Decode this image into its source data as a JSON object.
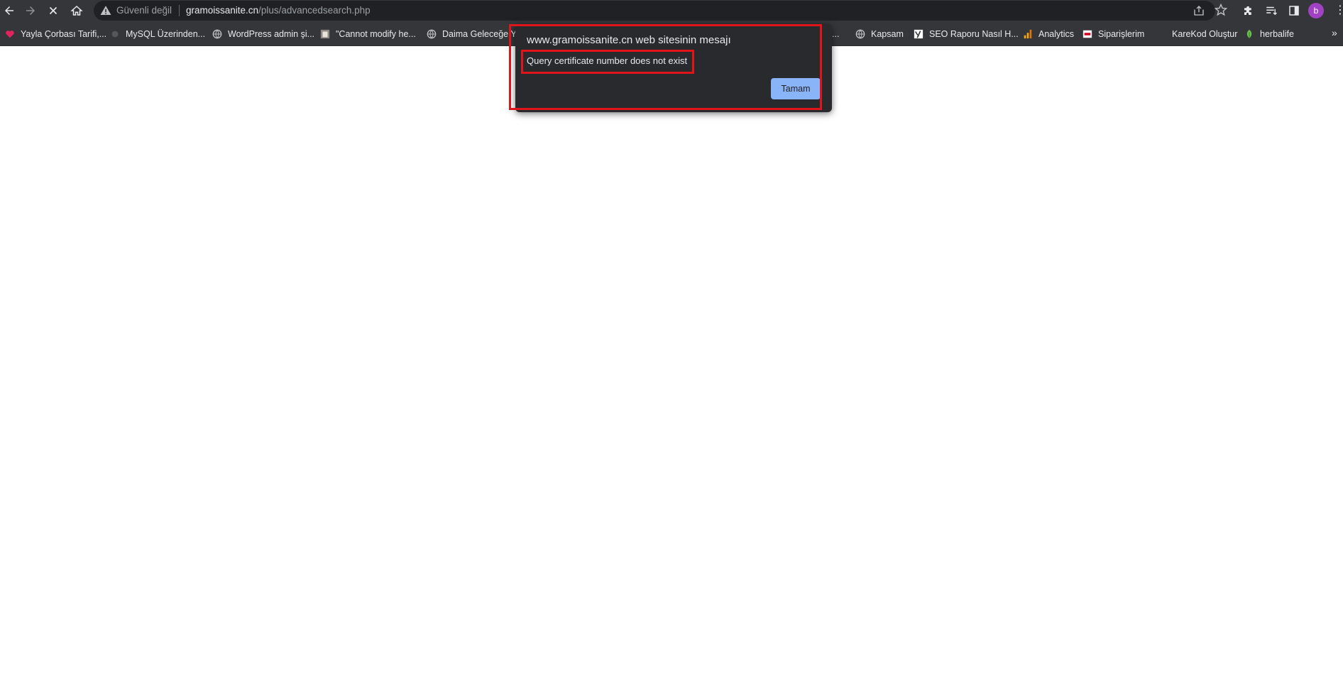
{
  "browser": {
    "security_text": "Güvenli değil",
    "url_host": "gramoissanite.cn",
    "url_path": "/plus/advancedsearch.php",
    "profile_initial": "b"
  },
  "bookmarks": [
    {
      "label": "Yayla Çorbası Tarifi,...",
      "icon": "heart-icon"
    },
    {
      "label": "MySQL Üzerinden...",
      "icon": "site-icon"
    },
    {
      "label": "WordPress admin şi...",
      "icon": "globe-icon"
    },
    {
      "label": "\"Cannot modify he...",
      "icon": "image-icon"
    },
    {
      "label": "Daima Geleceğe Yö",
      "icon": "globe-icon"
    },
    {
      "label": "...",
      "icon": ""
    },
    {
      "label": "Kapsam",
      "icon": "globe-icon"
    },
    {
      "label": "SEO Raporu Nasıl H...",
      "icon": "yoast-icon"
    },
    {
      "label": "Analytics",
      "icon": "analytics-icon"
    },
    {
      "label": "Siparişlerim",
      "icon": "store-icon"
    },
    {
      "label": "KareKod Oluştur",
      "icon": ""
    },
    {
      "label": "herbalife",
      "icon": "leaf-icon"
    }
  ],
  "bookmarks_more": "»",
  "dialog": {
    "title": "www.gramoissanite.cn web sitesinin mesajı",
    "message": "Query certificate number does not exist",
    "ok_label": "Tamam"
  },
  "colors": {
    "annotation": "#e0141b",
    "button": "#8ab4f8",
    "chrome_dark": "#35363a"
  }
}
